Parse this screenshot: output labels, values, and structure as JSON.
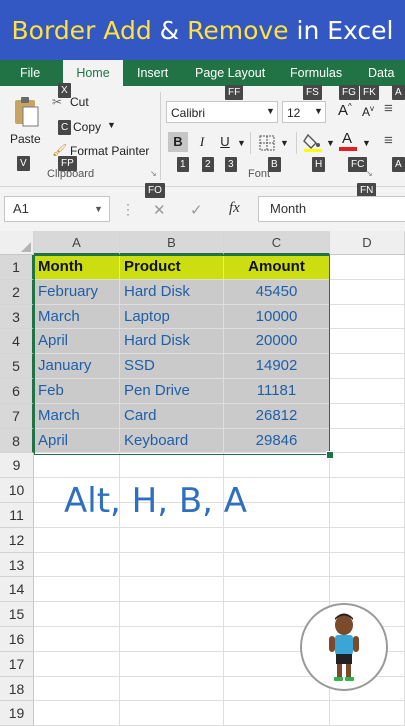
{
  "banner": {
    "part1": "Border Add",
    "amp": " & ",
    "part2": "Remove",
    "part3": " in Excel"
  },
  "ribbon_tabs": [
    "File",
    "Home",
    "Insert",
    "Page Layout",
    "Formulas",
    "Data"
  ],
  "active_tab": "Home",
  "clipboard": {
    "paste": "Paste",
    "cut": "Cut",
    "copy": "Copy",
    "format_painter": "Format Painter",
    "group_name": "Clipboard"
  },
  "font": {
    "name": "Calibri",
    "size": "12",
    "bold": "B",
    "italic": "I",
    "underline": "U",
    "group_name": "Font"
  },
  "keytips": {
    "x": "X",
    "c": "C",
    "v": "V",
    "fp": "FP",
    "ff": "FF",
    "fs": "FS",
    "fg": "FG",
    "fk": "FK",
    "a1": "A",
    "k1": "1",
    "k2": "2",
    "k3": "3",
    "b": "B",
    "h": "H",
    "fc": "FC",
    "a2": "A",
    "fo": "FO",
    "fn": "FN"
  },
  "formula_bar": {
    "name_box": "A1",
    "fx": "fx",
    "content": "Month"
  },
  "grid": {
    "columns": [
      "A",
      "B",
      "C",
      "D"
    ],
    "rows": [
      "1",
      "2",
      "3",
      "4",
      "5",
      "6",
      "7",
      "8",
      "9",
      "10",
      "11",
      "12",
      "13",
      "14",
      "15",
      "16",
      "17",
      "18",
      "19"
    ],
    "headers": [
      "Month",
      "Product",
      "Amount"
    ],
    "data": [
      [
        "February",
        "Hard Disk",
        "45450"
      ],
      [
        "March",
        "Laptop",
        "10000"
      ],
      [
        "April",
        "Hard Disk",
        "20000"
      ],
      [
        "January",
        "SSD",
        "14902"
      ],
      [
        "Feb",
        "Pen Drive",
        "11181"
      ],
      [
        "March",
        "Card",
        "26812"
      ],
      [
        "April",
        "Keyboard",
        "29846"
      ]
    ]
  },
  "shortcut_text": "Alt, H, B, A",
  "colors": {
    "banner_bg": "#3358c4",
    "banner_highlight": "#ffe23c",
    "ribbon_green": "#217346",
    "header_fill": "#ccdd10",
    "selection_fill": "#cacaca",
    "data_text": "#1f5fa8",
    "selection_border": "#217346"
  }
}
